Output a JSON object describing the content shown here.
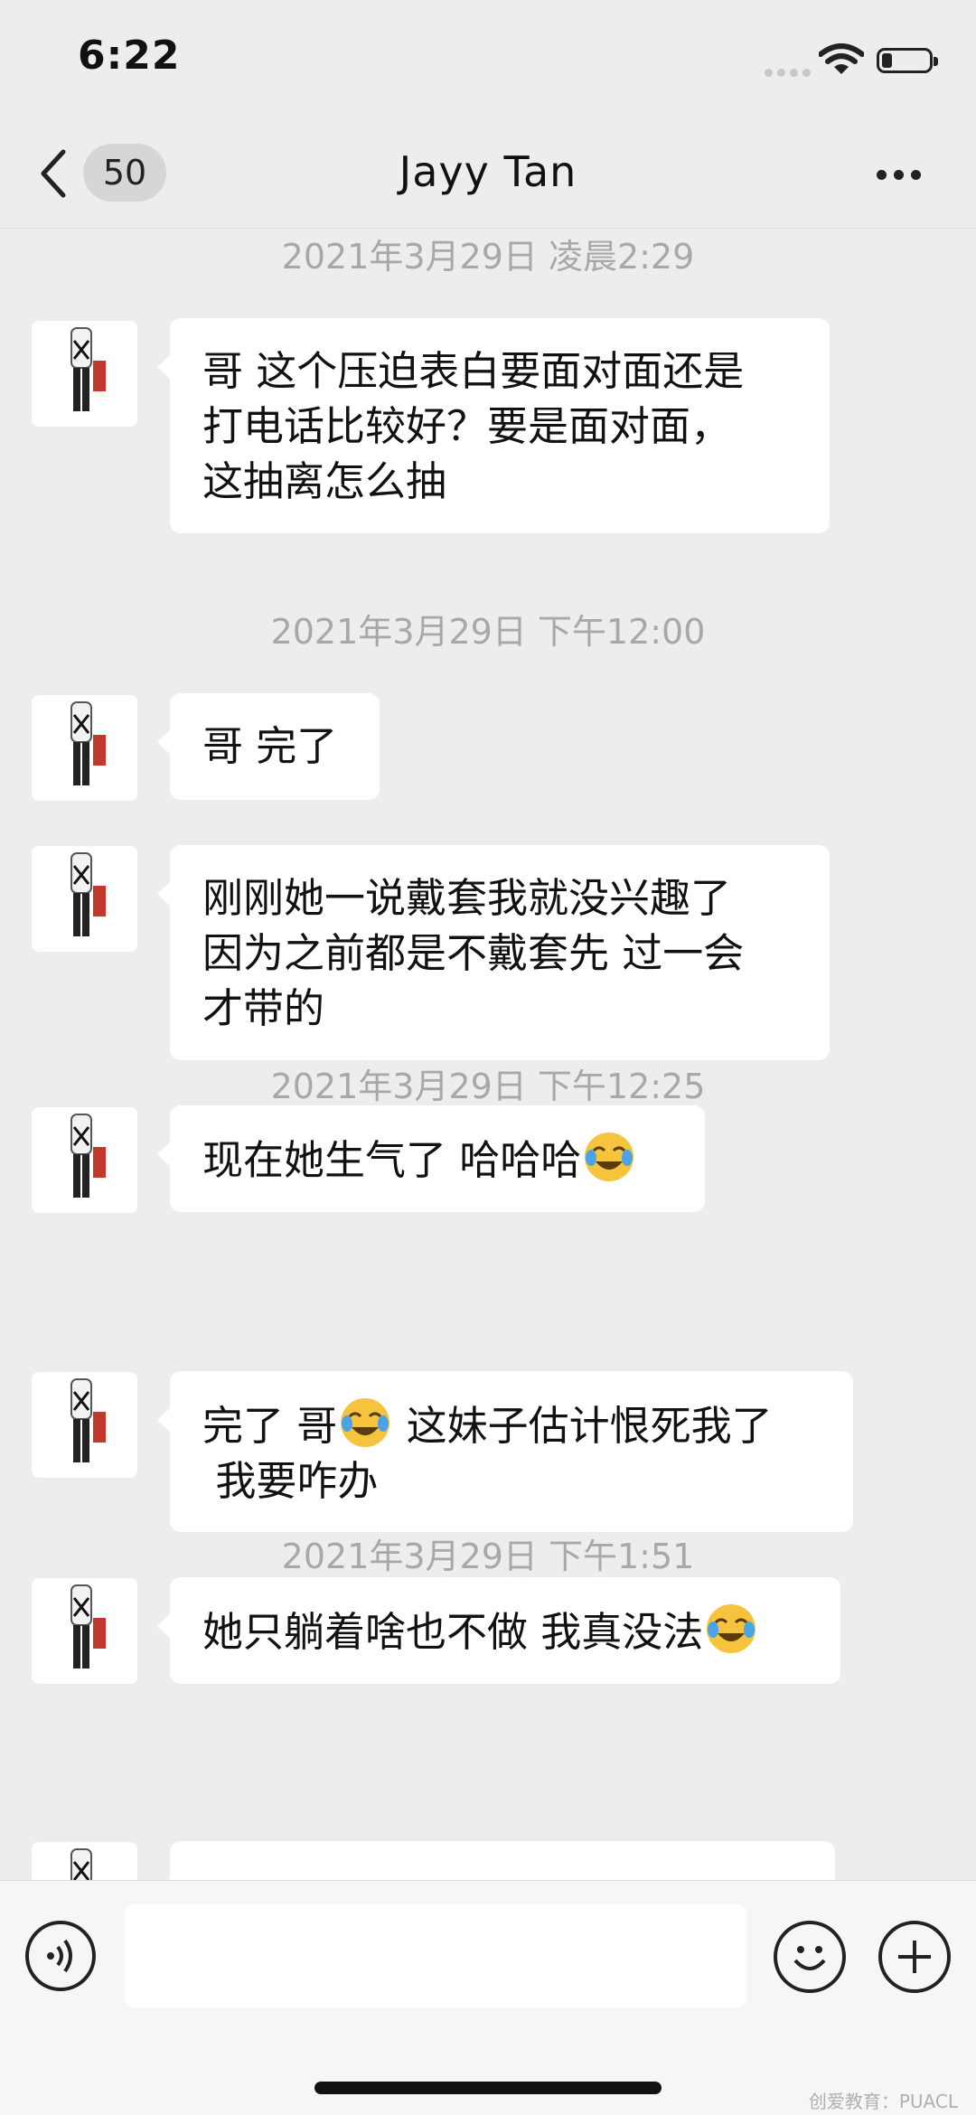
{
  "status_bar": {
    "time": "6:22"
  },
  "header": {
    "unread_count": "50",
    "title": "Jayy Tan"
  },
  "messages": [
    {
      "timestamp": "2021年3月29日 凌晨2:29"
    },
    {
      "text": "哥 这个压迫表白要面对面还是\n打电话比较好？要是面对面，\n这抽离怎么抽"
    },
    {
      "timestamp": "2021年3月29日 下午12:00"
    },
    {
      "text": "哥 完了"
    },
    {
      "text": "刚刚她一说戴套我就没兴趣了\n因为之前都是不戴套先 过一会\n才带的"
    },
    {
      "text_before": "现在她生气了 哈哈哈",
      "emoji": "face-with-tears-of-joy"
    },
    {
      "timestamp": "2021年3月29日 下午12:25"
    },
    {
      "text_before": "完了 哥",
      "emoji": "face-with-tears-of-joy",
      "text_after": " 这妹子估计恨死我了\n 我要咋办"
    },
    {
      "text_before": "她只躺着啥也不做 我真没法",
      "emoji": "face-with-tears-of-joy"
    },
    {
      "timestamp": "2021年3月29日 下午1:51"
    }
  ],
  "input_bar": {
    "placeholder": ""
  },
  "watermark": "创爱教育：PUACL",
  "icons": {
    "back": "chevron-left-icon",
    "more": "more-dots-icon",
    "voice": "voice-icon",
    "emoji": "smiley-icon",
    "plus": "plus-icon"
  },
  "colors": {
    "background": "#ededed",
    "bubble": "#ffffff",
    "timestamp": "#a8a8a8"
  }
}
